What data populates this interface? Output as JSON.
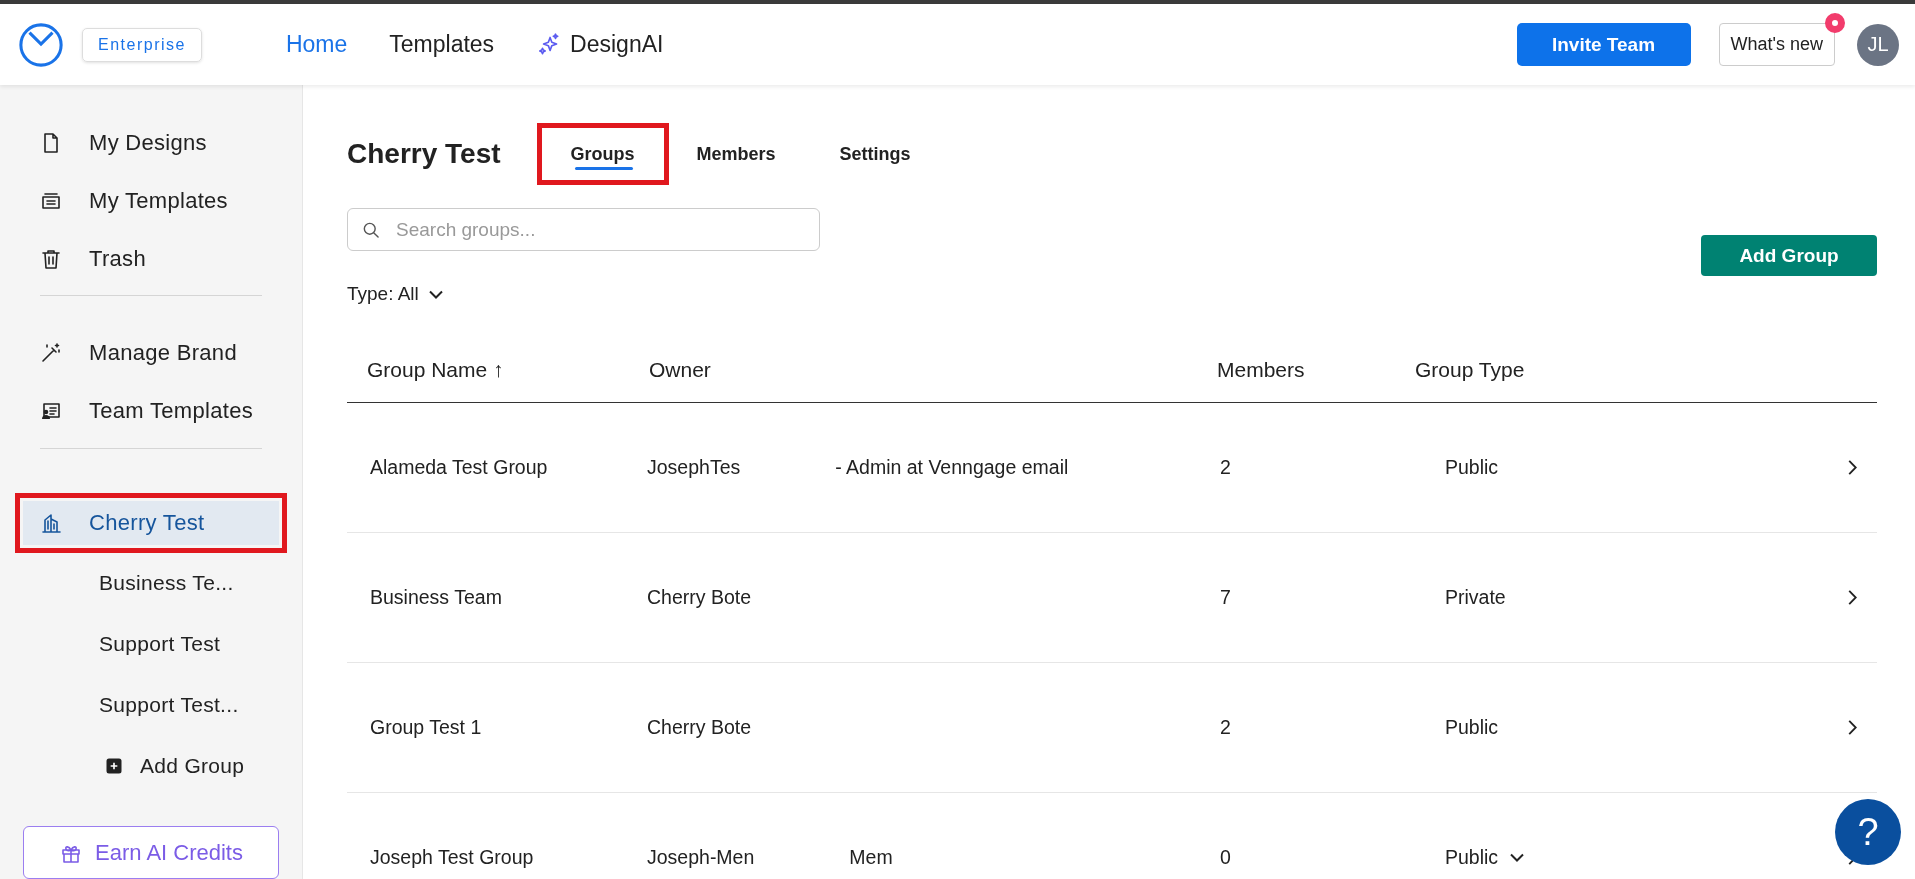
{
  "topbar": {
    "plan_badge": "Enterprise",
    "nav": [
      {
        "label": "Home",
        "selected": true,
        "kind": "plain"
      },
      {
        "label": "Templates",
        "selected": false,
        "kind": "plain"
      },
      {
        "label": "DesignAI",
        "selected": false,
        "kind": "ai"
      }
    ],
    "invite_button": "Invite Team",
    "whats_new": {
      "label": "What's new",
      "notification": true
    },
    "avatar": "JL"
  },
  "sidebar": {
    "items": [
      {
        "label": "My Designs",
        "selected": false,
        "highlighted": false
      },
      {
        "label": "My Templates",
        "selected": false,
        "highlighted": false
      },
      {
        "label": "Trash",
        "selected": false,
        "highlighted": false
      },
      {
        "kind": "divider"
      },
      {
        "label": "Manage Brand",
        "selected": false,
        "highlighted": false
      },
      {
        "label": "Team Templates",
        "selected": false,
        "highlighted": false
      },
      {
        "kind": "divider"
      },
      {
        "label": "Cherry Test",
        "selected": true,
        "highlighted": true,
        "children": [
          {
            "label": "Business Te...",
            "kind": "group"
          },
          {
            "label": "Support Test",
            "kind": "group"
          },
          {
            "label": "Support Test...",
            "kind": "group"
          },
          {
            "label": "Add Group",
            "kind": "add"
          }
        ]
      }
    ],
    "earn_button": "Earn AI Credits"
  },
  "page": {
    "title": "Cherry Test",
    "tabs": [
      {
        "label": "Groups",
        "selected": true,
        "highlighted": true
      },
      {
        "label": "Members",
        "selected": false,
        "highlighted": false
      },
      {
        "label": "Settings",
        "selected": false,
        "highlighted": false
      }
    ],
    "search": {
      "placeholder": "Search groups..."
    },
    "filter": "Type: All",
    "add_button": "Add Group"
  },
  "table": {
    "columns": [
      "Group Name ↑",
      "Owner",
      "Members",
      "Group Type"
    ],
    "rows": [
      {
        "name": "Alameda Test Group",
        "owner": "JosephTes",
        "owner_rest": "- Admin at Venngage email",
        "members": "2",
        "type": "Public",
        "dropdown": false
      },
      {
        "name": "Business Team",
        "owner": "Cherry Bote",
        "members": "7",
        "type": "Private",
        "dropdown": false
      },
      {
        "name": "Group Test 1",
        "owner": "Cherry Bote",
        "members": "2",
        "type": "Public",
        "dropdown": false
      },
      {
        "name": "Joseph Test Group",
        "owner": "Joseph-Men",
        "owner_rest": "Mem",
        "members": "0",
        "type": "Public",
        "dropdown": true
      }
    ]
  },
  "help_button": "?"
}
